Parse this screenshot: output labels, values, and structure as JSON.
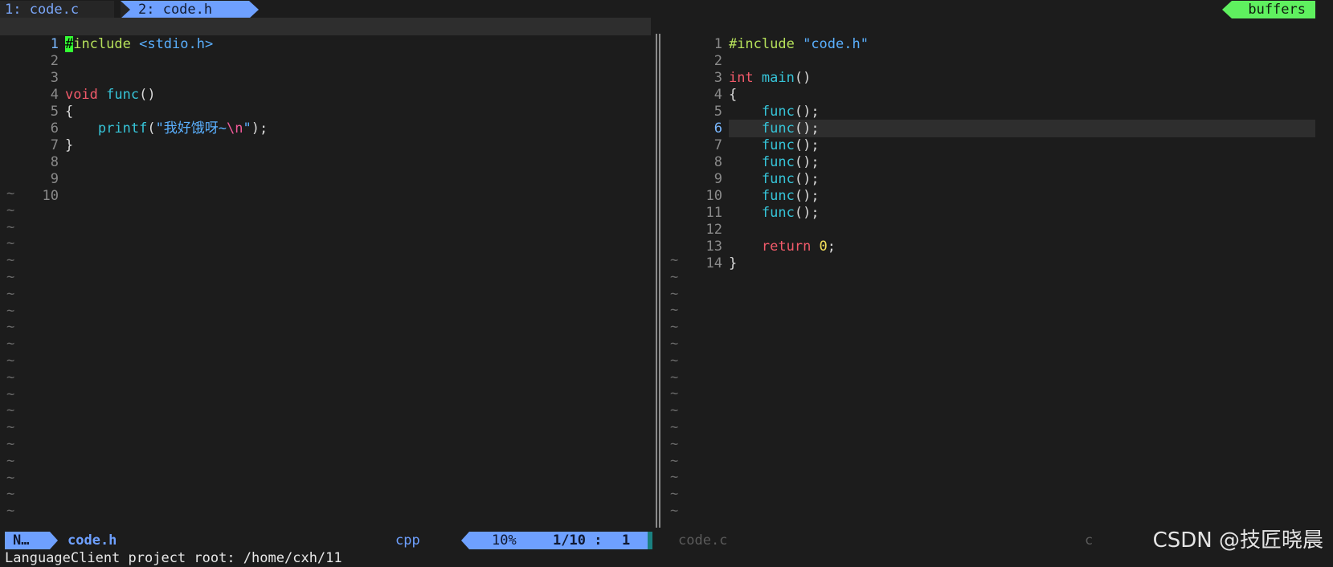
{
  "tabline": {
    "tabs": [
      {
        "label": "1: code.c",
        "active": false
      },
      {
        "label": "2: code.h",
        "active": true
      }
    ],
    "buffers_label": "buffers"
  },
  "left_pane": {
    "lines": [
      {
        "n": "1",
        "current": true
      },
      {
        "n": "2"
      },
      {
        "n": "3"
      },
      {
        "n": "4"
      },
      {
        "n": "5"
      },
      {
        "n": "6"
      },
      {
        "n": "7"
      },
      {
        "n": "8"
      },
      {
        "n": "9"
      },
      {
        "n": "10"
      }
    ],
    "code": {
      "l1_cursor": "#",
      "l1_include": "include",
      "l1_header": " <stdio.h>",
      "l4_kw": "void",
      "l4_fn": " func",
      "l4_rest": "()",
      "l5": "{",
      "l6_fn": "    printf",
      "l6_open": "(",
      "l6_str": "\"我好饿呀~",
      "l6_esc": "\\n",
      "l6_strend": "\"",
      "l6_close": ");",
      "l7": "}"
    },
    "tilde": "~"
  },
  "right_pane": {
    "lines": [
      {
        "n": "1"
      },
      {
        "n": "2"
      },
      {
        "n": "3"
      },
      {
        "n": "4"
      },
      {
        "n": "5"
      },
      {
        "n": "6",
        "current": true
      },
      {
        "n": "7"
      },
      {
        "n": "8"
      },
      {
        "n": "9"
      },
      {
        "n": "10"
      },
      {
        "n": "11"
      },
      {
        "n": "12"
      },
      {
        "n": "13"
      },
      {
        "n": "14"
      }
    ],
    "code": {
      "l1_include": "#include",
      "l1_header": " \"code.h\"",
      "l3_kw": "int",
      "l3_fn": " main",
      "l3_rest": "()",
      "l4": "{",
      "func_call": "    func",
      "func_rest": "();",
      "l13_kw": "    return",
      "l13_num": " 0",
      "l13_rest": ";",
      "l14": "}"
    },
    "tilde": "~"
  },
  "statusline": {
    "mode": "N…",
    "filename": "code.h",
    "filetype": "cpp",
    "percent": "10%",
    "lines": "1/10",
    "separator": ":",
    "column": "1",
    "right_filename": "code.c",
    "right_filetype": "c"
  },
  "cmdline": "LanguageClient project root: /home/cxh/11",
  "watermark": "CSDN @技匠晓晨",
  "colors": {
    "background": "#1c1c1c",
    "accent_blue": "#6ea0ff",
    "buffers_green": "#5ff05f",
    "keyword_red": "#f25a6a",
    "function_cyan": "#36c4d8",
    "include_green": "#b5e05a"
  }
}
